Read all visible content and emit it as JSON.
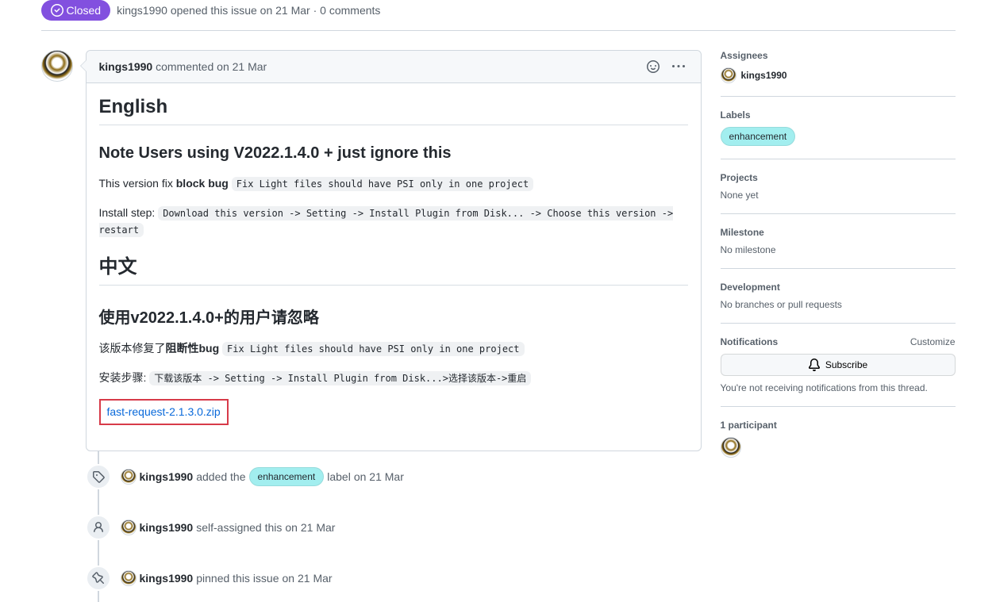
{
  "header": {
    "status": "Closed",
    "author": "kings1990",
    "action": "opened this issue",
    "date": "on 21 Mar",
    "comments": "0 comments"
  },
  "comment": {
    "author": "kings1990",
    "action": "commented",
    "date": "on 21 Mar",
    "h2_en": "English",
    "h3_en": "Note Users using V2022.1.4.0 + just ignore this",
    "p1_prefix": "This version fix ",
    "p1_bold": "block bug",
    "p1_code": "Fix Light files should have PSI only in one project",
    "p2_prefix": "Install step: ",
    "p2_code": "Download this version -> Setting -> Install Plugin from Disk... -> Choose this version -> restart",
    "h2_zh": "中文",
    "h3_zh": "使用v2022.1.4.0+的用户请忽略",
    "p3_prefix": "该版本修复了",
    "p3_bold": "阻断性bug",
    "p3_code": "Fix Light files should have PSI only in one project",
    "p4_prefix": "安装步骤: ",
    "p4_code": "下载该版本 -> Setting -> Install Plugin from Disk...>选择该版本->重启",
    "attachment": "fast-request-2.1.3.0.zip"
  },
  "timeline": {
    "item1": {
      "author": "kings1990",
      "action_pre": "added the",
      "label": "enhancement",
      "action_post": "label",
      "date": "on 21 Mar"
    },
    "item2": {
      "author": "kings1990",
      "action": "self-assigned this",
      "date": "on 21 Mar"
    },
    "item3": {
      "author": "kings1990",
      "action": "pinned this issue",
      "date": "on 21 Mar"
    }
  },
  "sidebar": {
    "assignees": {
      "heading": "Assignees",
      "user": "kings1990"
    },
    "labels": {
      "heading": "Labels",
      "label": "enhancement"
    },
    "projects": {
      "heading": "Projects",
      "value": "None yet"
    },
    "milestone": {
      "heading": "Milestone",
      "value": "No milestone"
    },
    "development": {
      "heading": "Development",
      "value": "No branches or pull requests"
    },
    "notifications": {
      "heading": "Notifications",
      "customize": "Customize",
      "subscribe": "Subscribe",
      "desc": "You're not receiving notifications from this thread."
    },
    "participants": {
      "heading": "1 participant"
    }
  }
}
